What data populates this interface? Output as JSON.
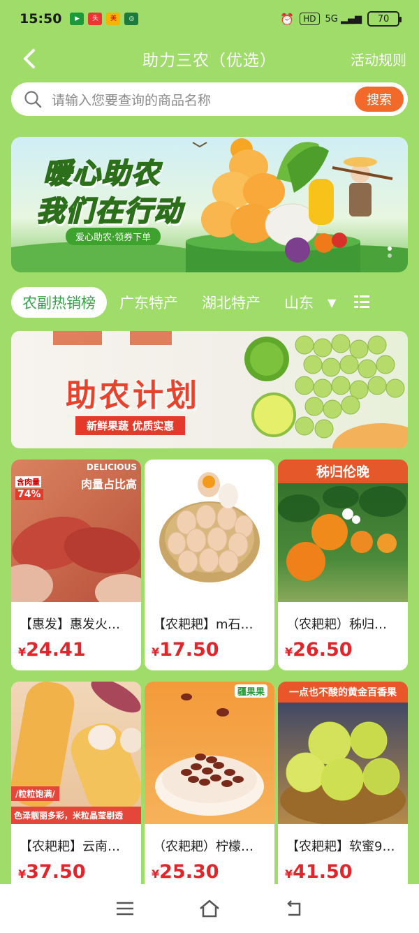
{
  "status_bar": {
    "time": "15:50",
    "hd": "HD",
    "signal": "5G",
    "battery": "70"
  },
  "header": {
    "title": "助力三农（优选）",
    "rules": "活动规则"
  },
  "search": {
    "placeholder": "请输入您要查询的商品名称",
    "button": "搜索"
  },
  "banner": {
    "title_line1": "暖心助农",
    "title_line2": "我们在行动",
    "tag": "爱心助农·领券下单"
  },
  "tabs": [
    "农副热销榜",
    "广东特产",
    "湖北特产",
    "山东"
  ],
  "promo": {
    "title": "助农计划",
    "subtitle": "新鲜果蔬 优质实惠"
  },
  "products": [
    {
      "name": "【惠发】惠发火…",
      "price": "24.41",
      "img_text1": "DELICIOUS",
      "img_text2": "肉量占比高",
      "img_text3": "含肉量",
      "img_text4": "74%"
    },
    {
      "name": "【农耙耙】m石…",
      "price": "17.50"
    },
    {
      "name": "（农耙耙）秭归…",
      "price": "26.50",
      "img_text1": "秭归伦晚"
    },
    {
      "name": "【农耙耙】云南…",
      "price": "37.50",
      "img_text1": "/粒粒饱满/",
      "img_text2": "色泽靓丽多彩，米粒晶莹剔透"
    },
    {
      "name": "（农耙耙）柠檬…",
      "price": "25.30",
      "img_text1": "疆果果"
    },
    {
      "name": "【农耙耙】软蜜9…",
      "price": "41.50",
      "img_text1": "一点也不酸的黄金百香果"
    }
  ],
  "currency_symbol": "¥",
  "colors": {
    "background": "#9fdc6a",
    "accent_orange": "#f26a2a",
    "price_red": "#e0262b",
    "tab_active_text": "#3aa34a"
  }
}
